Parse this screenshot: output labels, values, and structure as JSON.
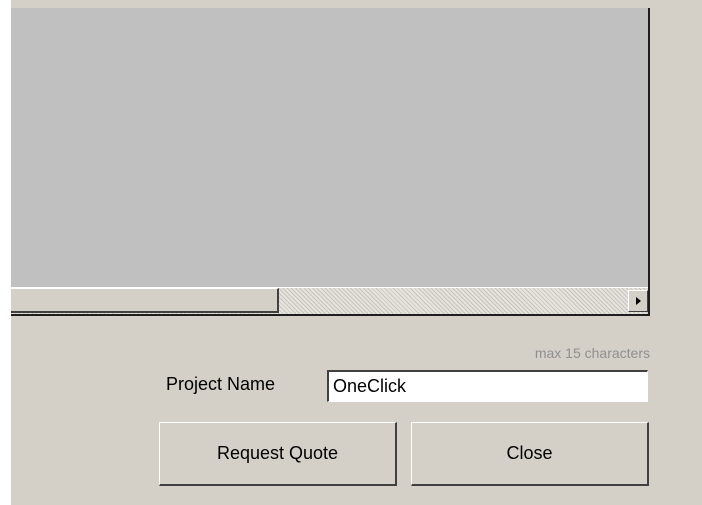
{
  "form": {
    "hint": "max 15 characters",
    "project_label": "Project Name",
    "project_value": "OneClick"
  },
  "buttons": {
    "request_quote": "Request Quote",
    "close": "Close"
  },
  "colors": {
    "dialog_bg": "#d4d0c8",
    "preview_bg": "#c0c0c0"
  },
  "icons": {
    "scroll_right": "scroll-right-arrow-icon"
  }
}
